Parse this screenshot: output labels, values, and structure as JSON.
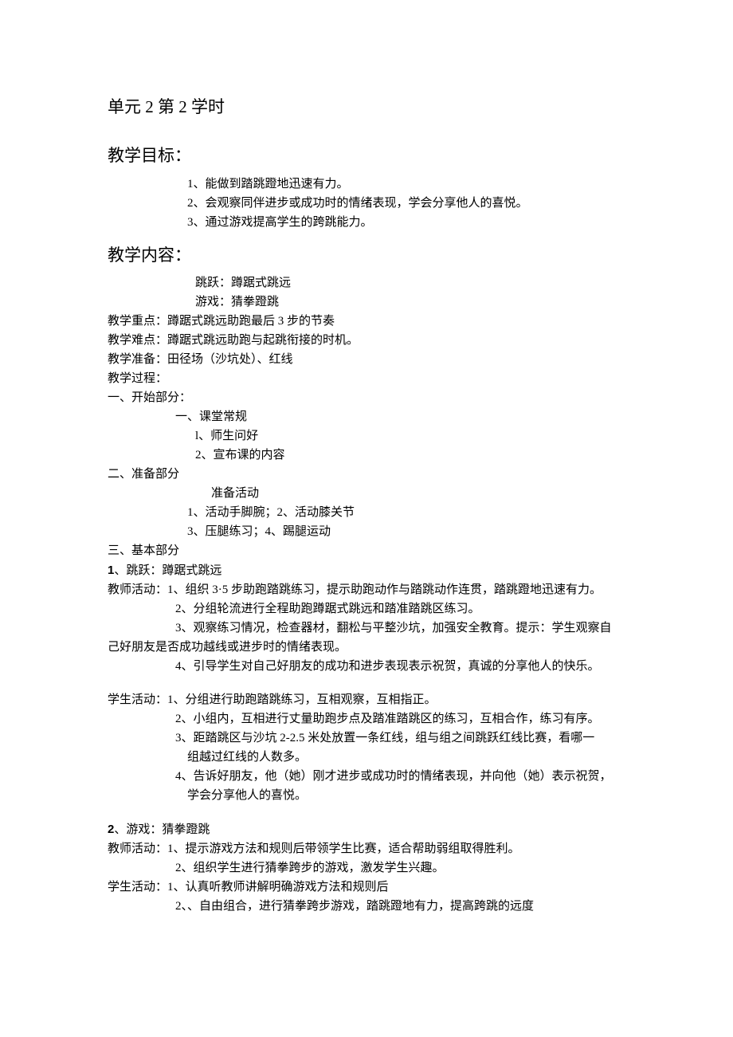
{
  "title": "单元 2 第 2 学时",
  "sections": {
    "objectives": {
      "heading": "教学目标：",
      "items": [
        "1、能做到踏跳蹬地迅速有力。",
        "2、会观察同伴进步或成功时的情绪表现，学会分享他人的喜悦。",
        "3、通过游戏提高学生的跨跳能力。"
      ]
    },
    "content": {
      "heading": "教学内容：",
      "intro": [
        "跳跃：蹲踞式跳远",
        "游戏：猜拳蹬跳"
      ],
      "key_point_label": "教学重点：",
      "key_point_text": "蹲踞式跳远助跑最后 3 步的节奏",
      "difficulty_label": "教学难点：",
      "difficulty_text": "蹲踞式跳远助跑与起跳衔接的时机。",
      "preparation_label": "教学准备：",
      "preparation_text": "田径场（沙坑处）、红线",
      "process_label": "教学过程："
    },
    "part1": {
      "heading": "一、开始部分：",
      "sub_heading": "一、课堂常规",
      "items": [
        "l、师生问好",
        "2、宣布课的内容"
      ]
    },
    "part2": {
      "heading": "二、准备部分",
      "sub_heading": "准备活动",
      "items": [
        "1、活动手脚腕；2、活动膝关节",
        "3、压腿练习；4、踢腿运动"
      ]
    },
    "part3": {
      "heading": "三、基本部分",
      "activity1": {
        "num": "1",
        "title": "、跳跃：蹲踞式跳远",
        "teacher_label": "教师活动",
        "teacher_first": "：1、组织 3·5 步助跑踏跳练习，提示助跑动作与踏跳动作连贯，踏跳蹬地迅速有力。",
        "teacher_items": [
          "2、分组轮流进行全程助跑蹲踞式跳远和踏准踏跳区练习。",
          "3、观察练习情况，检查器材，翻松与平整沙坑，加强安全教育。提示：学生观察自"
        ],
        "teacher_cont": "己好朋友是否成功越线或进步时的情绪表现。",
        "teacher_item4": "4、引导学生对自己好朋友的成功和进步表现表示祝贺，真诚的分享他人的快乐。",
        "student_label": "学生活动：",
        "student_first": "1、分组进行助跑踏跳练习，互相观察，互相指正。",
        "student_items": [
          "2、小组内，互相进行丈量助跑步点及踏准踏跳区的练习，互相合作，练习有序。",
          "3、距踏跳区与沙坑 2-2.5 米处放置一条红线，组与组之间跳跃红线比赛，看哪一"
        ],
        "student_cont3": "组越过红线的人数多。",
        "student_item4": "4、告诉好朋友，他（她）刚才进步或成功时的情绪表现，并向他（她）表示祝贺，",
        "student_cont4": "学会分享他人的喜悦。"
      },
      "activity2": {
        "num": "2",
        "title": "、游戏：猜拳蹬跳",
        "teacher_label": "教师活动：",
        "teacher_first": "1、提示游戏方法和规则后带领学生比赛，适合帮助弱组取得胜利。",
        "teacher_item2": "2、组织学生进行猜拳跨步的游戏，激发学生兴趣。",
        "student_label": "学生活动：",
        "student_first": "1、认真听教师讲解明确游戏方法和规则后",
        "student_item2": "2、、自由组合，进行猜拳跨步游戏，踏跳蹬地有力，提高跨跳的远度"
      }
    }
  }
}
